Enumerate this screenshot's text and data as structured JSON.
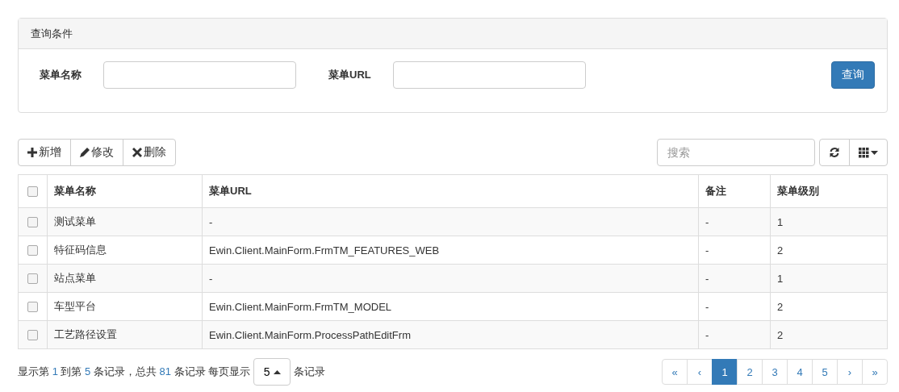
{
  "query_panel": {
    "title": "查询条件",
    "fields": [
      {
        "label": "菜单名称"
      },
      {
        "label": "菜单URL"
      }
    ],
    "button": "查询"
  },
  "toolbar": {
    "buttons": [
      {
        "kind": "plus",
        "label": "新增"
      },
      {
        "kind": "pencil",
        "label": "修改"
      },
      {
        "kind": "cross",
        "label": "删除"
      }
    ],
    "search": {
      "placeholder": "搜索"
    }
  },
  "table": {
    "columns": [
      "菜单名称",
      "菜单URL",
      "备注",
      "菜单级别"
    ],
    "all_checked": false,
    "rows": [
      {
        "checked": false,
        "cells": [
          "测试菜单",
          "-",
          "-",
          "1"
        ]
      },
      {
        "checked": false,
        "cells": [
          "特征码信息",
          "Ewin.Client.MainForm.FrmTM_FEATURES_WEB",
          "-",
          "2"
        ]
      },
      {
        "checked": false,
        "cells": [
          "站点菜单",
          "-",
          "-",
          "1"
        ]
      },
      {
        "checked": false,
        "cells": [
          "车型平台",
          "Ewin.Client.MainForm.FrmTM_MODEL",
          "-",
          "2"
        ]
      },
      {
        "checked": false,
        "cells": [
          "工艺路径设置",
          "Ewin.Client.MainForm.ProcessPathEditFrm",
          "-",
          "2"
        ]
      }
    ]
  },
  "footer": {
    "parts": [
      {
        "kind": "text",
        "text": "显示第 "
      },
      {
        "kind": "number",
        "text": "1"
      },
      {
        "kind": "text",
        "text": " 到第 "
      },
      {
        "kind": "number",
        "text": "5"
      },
      {
        "kind": "text",
        "text": " 条记录，总共 "
      },
      {
        "kind": "number",
        "text": "81"
      },
      {
        "kind": "text",
        "text": " 条记录 每页显示"
      }
    ],
    "page_size": "5",
    "suffix": "条记录",
    "pages": [
      {
        "label": "«",
        "selected": false
      },
      {
        "label": "‹",
        "selected": false
      },
      {
        "label": "1",
        "selected": true
      },
      {
        "label": "2",
        "selected": false
      },
      {
        "label": "3",
        "selected": false
      },
      {
        "label": "4",
        "selected": false
      },
      {
        "label": "5",
        "selected": false
      },
      {
        "label": "›",
        "selected": false
      },
      {
        "label": "»",
        "selected": false
      }
    ]
  }
}
